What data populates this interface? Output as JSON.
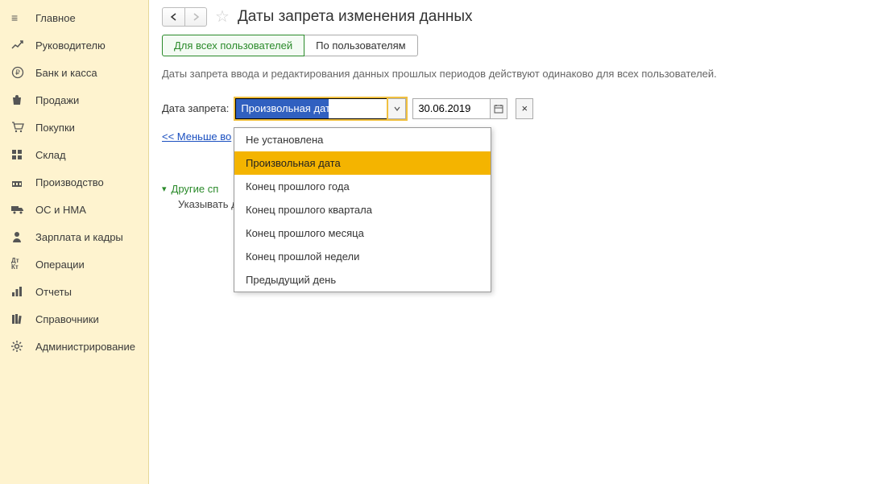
{
  "sidebar": {
    "items": [
      {
        "label": "Главное",
        "icon": "menu"
      },
      {
        "label": "Руководителю",
        "icon": "chart-line"
      },
      {
        "label": "Банк и касса",
        "icon": "ruble"
      },
      {
        "label": "Продажи",
        "icon": "bag"
      },
      {
        "label": "Покупки",
        "icon": "cart"
      },
      {
        "label": "Склад",
        "icon": "boxes"
      },
      {
        "label": "Производство",
        "icon": "factory"
      },
      {
        "label": "ОС и НМА",
        "icon": "truck"
      },
      {
        "label": "Зарплата и кадры",
        "icon": "person"
      },
      {
        "label": "Операции",
        "icon": "dtkt"
      },
      {
        "label": "Отчеты",
        "icon": "bars"
      },
      {
        "label": "Справочники",
        "icon": "books"
      },
      {
        "label": "Администрирование",
        "icon": "gear"
      }
    ]
  },
  "header": {
    "title": "Даты запрета изменения данных"
  },
  "tabs": [
    {
      "label": "Для всех пользователей",
      "active": true
    },
    {
      "label": "По пользователям",
      "active": false
    }
  ],
  "info": "Даты запрета ввода и редактирования данных прошлых периодов действуют одинаково для всех пользователей.",
  "form": {
    "label": "Дата запрета:",
    "combo_value": "Произвольная дата",
    "date_value": "30.06.2019"
  },
  "less_link": "<< Меньше во",
  "section": {
    "title": "Другие сп",
    "body": "Указывать да"
  },
  "dropdown": {
    "options": [
      "Не установлена",
      "Произвольная дата",
      "Конец прошлого года",
      "Конец прошлого квартала",
      "Конец прошлого месяца",
      "Конец прошлой недели",
      "Предыдущий день"
    ],
    "selected_index": 1
  },
  "icons": {
    "menu": "≡",
    "chart-line": "📈",
    "ruble": "₽",
    "bag": "🛍",
    "cart": "🛒",
    "boxes": "▦",
    "factory": "▤",
    "truck": "🚚",
    "person": "👤",
    "dtkt": "Дт Кт",
    "bars": "▮▮",
    "books": "📚",
    "gear": "⚙"
  }
}
